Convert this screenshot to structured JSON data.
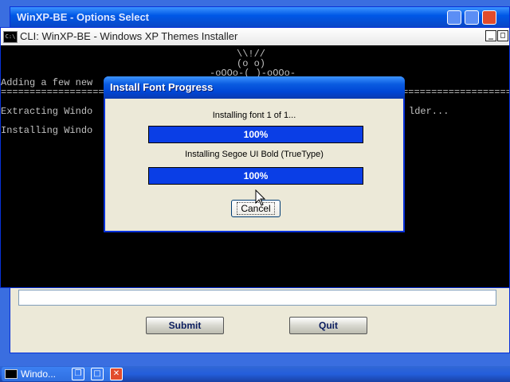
{
  "back_window": {
    "title": "WinXP-BE - Options Select",
    "submit_label": "Submit",
    "quit_label": "Quit"
  },
  "console": {
    "title": "CLI: WinXP-BE - Windows XP Themes Installer",
    "icon_text": "C:\\",
    "min_glyph": "_",
    "max_glyph": "□",
    "art_line1": "\\\\!//",
    "art_line2": "(o o)",
    "art_line3": "-oOOo-( )-oOOo-",
    "line_adding": "Adding a few new",
    "separator": "=============================================================================================================",
    "line_extracting_left": "Extracting Windo",
    "line_extracting_right": "lder...",
    "line_installing_left": "Installing Windo"
  },
  "dialog": {
    "title": "Install Font Progress",
    "status1": "Installing font 1 of 1...",
    "progress1_value": 100,
    "progress1_label": "100%",
    "status2": "Installing Segoe UI Bold (TrueType)",
    "progress2_value": 100,
    "progress2_label": "100%",
    "cancel_label": "Cancel"
  },
  "taskbar": {
    "task_label": "Windo...",
    "restore_glyph": "❐",
    "max_glyph": "□",
    "close_glyph": "✕"
  },
  "colors": {
    "xp_blue": "#0a46c4",
    "progress_fill": "#0a3ee6",
    "console_bg": "#000000",
    "console_text": "#c0c0c0",
    "dialog_bg": "#ece9d8"
  }
}
